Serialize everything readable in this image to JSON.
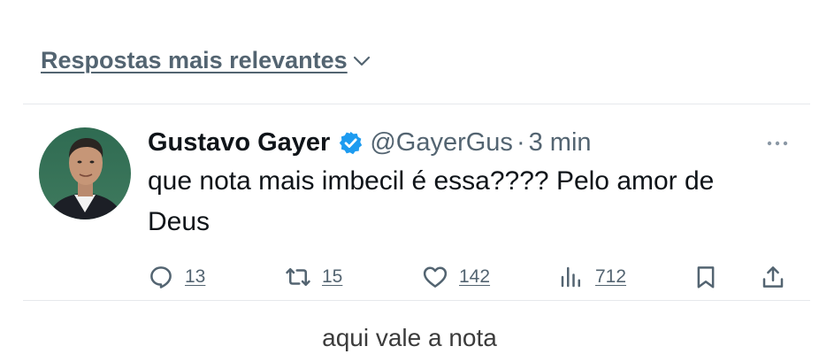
{
  "sort": {
    "label": "Respostas mais relevantes",
    "chevron_icon": "chevron-down-icon"
  },
  "tweet": {
    "author": {
      "display_name": "Gustavo Gayer",
      "handle": "@GayerGus",
      "verified": true,
      "verified_color": "#1d9bf0"
    },
    "separator": "·",
    "time": "3 min",
    "text": "que nota mais imbecil é essa???? Pelo amor de Deus",
    "actions": {
      "reply_count": "13",
      "retweet_count": "15",
      "like_count": "142",
      "views_count": "712"
    }
  },
  "caption": "aqui vale a nota",
  "colors": {
    "primary_text": "#0f1419",
    "secondary_text": "#536471",
    "divider": "#e6e9ec",
    "verified_blue": "#1d9bf0"
  }
}
